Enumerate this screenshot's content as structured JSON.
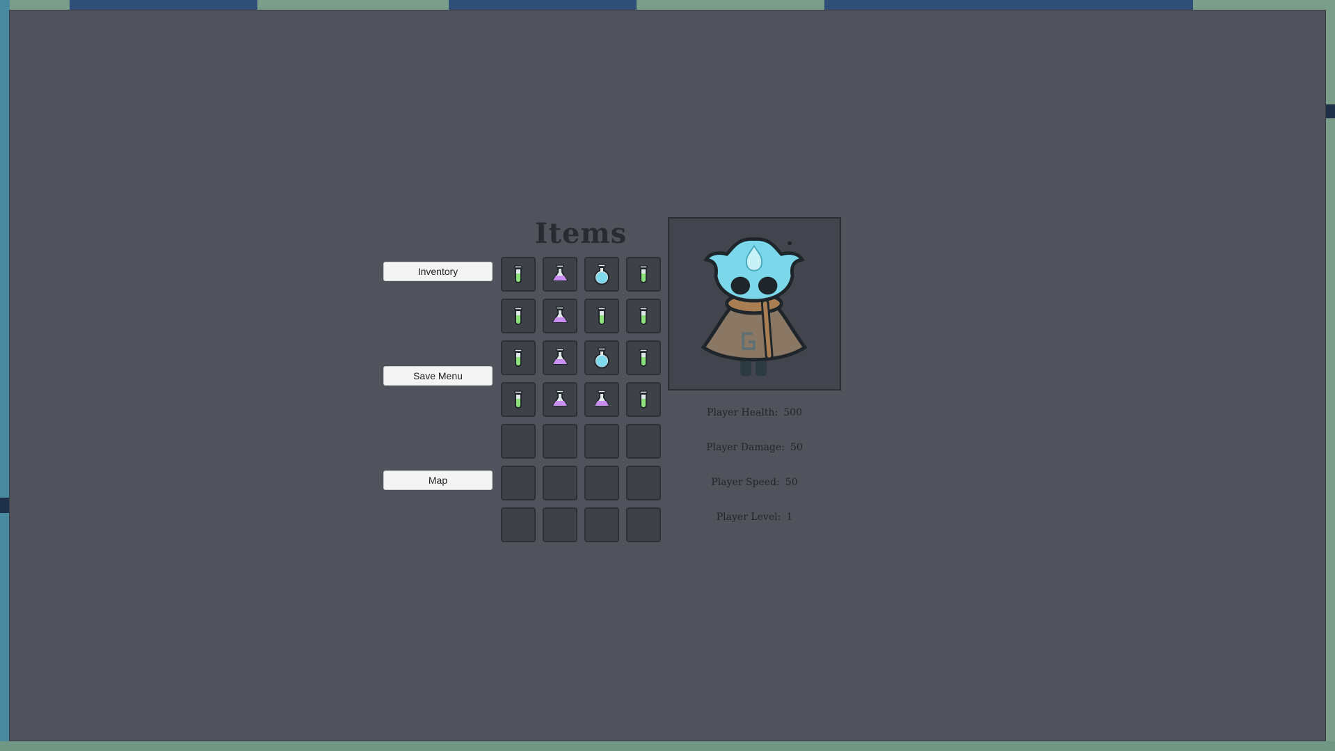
{
  "screen": {
    "title": "Items",
    "menu": {
      "inventory_label": "Inventory",
      "save_menu_label": "Save Menu",
      "map_label": "Map"
    },
    "slots": [
      "green-potion-icon",
      "purple-potion-icon",
      "blue-potion-icon",
      "green-potion-icon",
      "green-potion-icon",
      "purple-potion-icon",
      "green-potion-icon",
      "green-potion-icon",
      "green-potion-icon",
      "purple-potion-icon",
      "blue-potion-icon",
      "green-potion-icon",
      "green-potion-icon",
      "purple-potion-icon",
      "purple-potion-icon",
      "green-potion-icon",
      "",
      "",
      "",
      "",
      "",
      "",
      "",
      "",
      "",
      "",
      "",
      ""
    ],
    "stats": {
      "health_label": "Player Health:",
      "health_value": "500",
      "damage_label": "Player Damage:",
      "damage_value": "50",
      "speed_label": "Player Speed:",
      "speed_value": "50",
      "level_label": "Player Level:",
      "level_value": "1"
    },
    "colors": {
      "overlay": "#50525c",
      "slot": "#3f4149",
      "green_potion": "#8ee07a",
      "purple_potion": "#c88ef0",
      "blue_potion": "#7fd8ec",
      "character_head": "#7ad8ea",
      "character_cloak": "#8a7764"
    }
  }
}
